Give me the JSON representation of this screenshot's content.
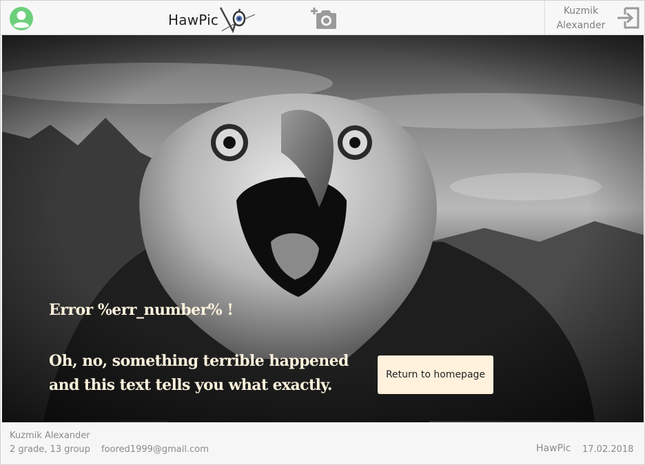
{
  "header": {
    "logo_text": "HawPic",
    "user_name_line1": "Kuzmik",
    "user_name_line2": "Alexander"
  },
  "icons": {
    "profile": "user-circle-icon",
    "add_photo": "add-photo-camera-icon",
    "logout": "logout-icon"
  },
  "hero": {
    "error_title": "Error %err_number% !",
    "error_line1": "Oh, no, something terrible happened",
    "error_line2": "and this text tells you what exactly.",
    "button_label": "Return to homepage"
  },
  "footer": {
    "author": "Kuzmik Alexander",
    "grade": "2 grade, 13 group",
    "email": "foored1999@gmail.com",
    "brand": "HawPic",
    "date": "17.02.2018"
  },
  "colors": {
    "accent_green": "#6ccf7a",
    "error_text": "#fbf1dc",
    "button_bg": "#fff1dc",
    "icon_gray": "#9a9a9a"
  }
}
